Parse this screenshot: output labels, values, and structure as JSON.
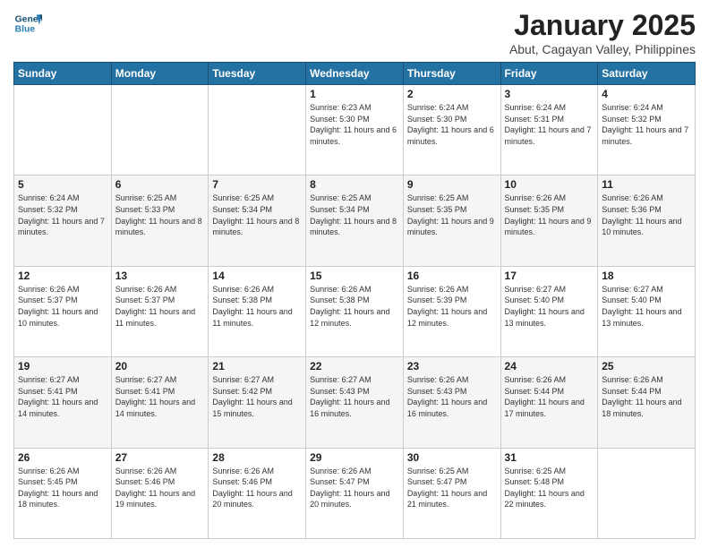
{
  "header": {
    "logo_line1": "General",
    "logo_line2": "Blue",
    "month": "January 2025",
    "location": "Abut, Cagayan Valley, Philippines"
  },
  "days_of_week": [
    "Sunday",
    "Monday",
    "Tuesday",
    "Wednesday",
    "Thursday",
    "Friday",
    "Saturday"
  ],
  "weeks": [
    [
      {
        "day": "",
        "text": ""
      },
      {
        "day": "",
        "text": ""
      },
      {
        "day": "",
        "text": ""
      },
      {
        "day": "1",
        "text": "Sunrise: 6:23 AM\nSunset: 5:30 PM\nDaylight: 11 hours and 6 minutes."
      },
      {
        "day": "2",
        "text": "Sunrise: 6:24 AM\nSunset: 5:30 PM\nDaylight: 11 hours and 6 minutes."
      },
      {
        "day": "3",
        "text": "Sunrise: 6:24 AM\nSunset: 5:31 PM\nDaylight: 11 hours and 7 minutes."
      },
      {
        "day": "4",
        "text": "Sunrise: 6:24 AM\nSunset: 5:32 PM\nDaylight: 11 hours and 7 minutes."
      }
    ],
    [
      {
        "day": "5",
        "text": "Sunrise: 6:24 AM\nSunset: 5:32 PM\nDaylight: 11 hours and 7 minutes."
      },
      {
        "day": "6",
        "text": "Sunrise: 6:25 AM\nSunset: 5:33 PM\nDaylight: 11 hours and 8 minutes."
      },
      {
        "day": "7",
        "text": "Sunrise: 6:25 AM\nSunset: 5:34 PM\nDaylight: 11 hours and 8 minutes."
      },
      {
        "day": "8",
        "text": "Sunrise: 6:25 AM\nSunset: 5:34 PM\nDaylight: 11 hours and 8 minutes."
      },
      {
        "day": "9",
        "text": "Sunrise: 6:25 AM\nSunset: 5:35 PM\nDaylight: 11 hours and 9 minutes."
      },
      {
        "day": "10",
        "text": "Sunrise: 6:26 AM\nSunset: 5:35 PM\nDaylight: 11 hours and 9 minutes."
      },
      {
        "day": "11",
        "text": "Sunrise: 6:26 AM\nSunset: 5:36 PM\nDaylight: 11 hours and 10 minutes."
      }
    ],
    [
      {
        "day": "12",
        "text": "Sunrise: 6:26 AM\nSunset: 5:37 PM\nDaylight: 11 hours and 10 minutes."
      },
      {
        "day": "13",
        "text": "Sunrise: 6:26 AM\nSunset: 5:37 PM\nDaylight: 11 hours and 11 minutes."
      },
      {
        "day": "14",
        "text": "Sunrise: 6:26 AM\nSunset: 5:38 PM\nDaylight: 11 hours and 11 minutes."
      },
      {
        "day": "15",
        "text": "Sunrise: 6:26 AM\nSunset: 5:38 PM\nDaylight: 11 hours and 12 minutes."
      },
      {
        "day": "16",
        "text": "Sunrise: 6:26 AM\nSunset: 5:39 PM\nDaylight: 11 hours and 12 minutes."
      },
      {
        "day": "17",
        "text": "Sunrise: 6:27 AM\nSunset: 5:40 PM\nDaylight: 11 hours and 13 minutes."
      },
      {
        "day": "18",
        "text": "Sunrise: 6:27 AM\nSunset: 5:40 PM\nDaylight: 11 hours and 13 minutes."
      }
    ],
    [
      {
        "day": "19",
        "text": "Sunrise: 6:27 AM\nSunset: 5:41 PM\nDaylight: 11 hours and 14 minutes."
      },
      {
        "day": "20",
        "text": "Sunrise: 6:27 AM\nSunset: 5:41 PM\nDaylight: 11 hours and 14 minutes."
      },
      {
        "day": "21",
        "text": "Sunrise: 6:27 AM\nSunset: 5:42 PM\nDaylight: 11 hours and 15 minutes."
      },
      {
        "day": "22",
        "text": "Sunrise: 6:27 AM\nSunset: 5:43 PM\nDaylight: 11 hours and 16 minutes."
      },
      {
        "day": "23",
        "text": "Sunrise: 6:26 AM\nSunset: 5:43 PM\nDaylight: 11 hours and 16 minutes."
      },
      {
        "day": "24",
        "text": "Sunrise: 6:26 AM\nSunset: 5:44 PM\nDaylight: 11 hours and 17 minutes."
      },
      {
        "day": "25",
        "text": "Sunrise: 6:26 AM\nSunset: 5:44 PM\nDaylight: 11 hours and 18 minutes."
      }
    ],
    [
      {
        "day": "26",
        "text": "Sunrise: 6:26 AM\nSunset: 5:45 PM\nDaylight: 11 hours and 18 minutes."
      },
      {
        "day": "27",
        "text": "Sunrise: 6:26 AM\nSunset: 5:46 PM\nDaylight: 11 hours and 19 minutes."
      },
      {
        "day": "28",
        "text": "Sunrise: 6:26 AM\nSunset: 5:46 PM\nDaylight: 11 hours and 20 minutes."
      },
      {
        "day": "29",
        "text": "Sunrise: 6:26 AM\nSunset: 5:47 PM\nDaylight: 11 hours and 20 minutes."
      },
      {
        "day": "30",
        "text": "Sunrise: 6:25 AM\nSunset: 5:47 PM\nDaylight: 11 hours and 21 minutes."
      },
      {
        "day": "31",
        "text": "Sunrise: 6:25 AM\nSunset: 5:48 PM\nDaylight: 11 hours and 22 minutes."
      },
      {
        "day": "",
        "text": ""
      }
    ]
  ]
}
